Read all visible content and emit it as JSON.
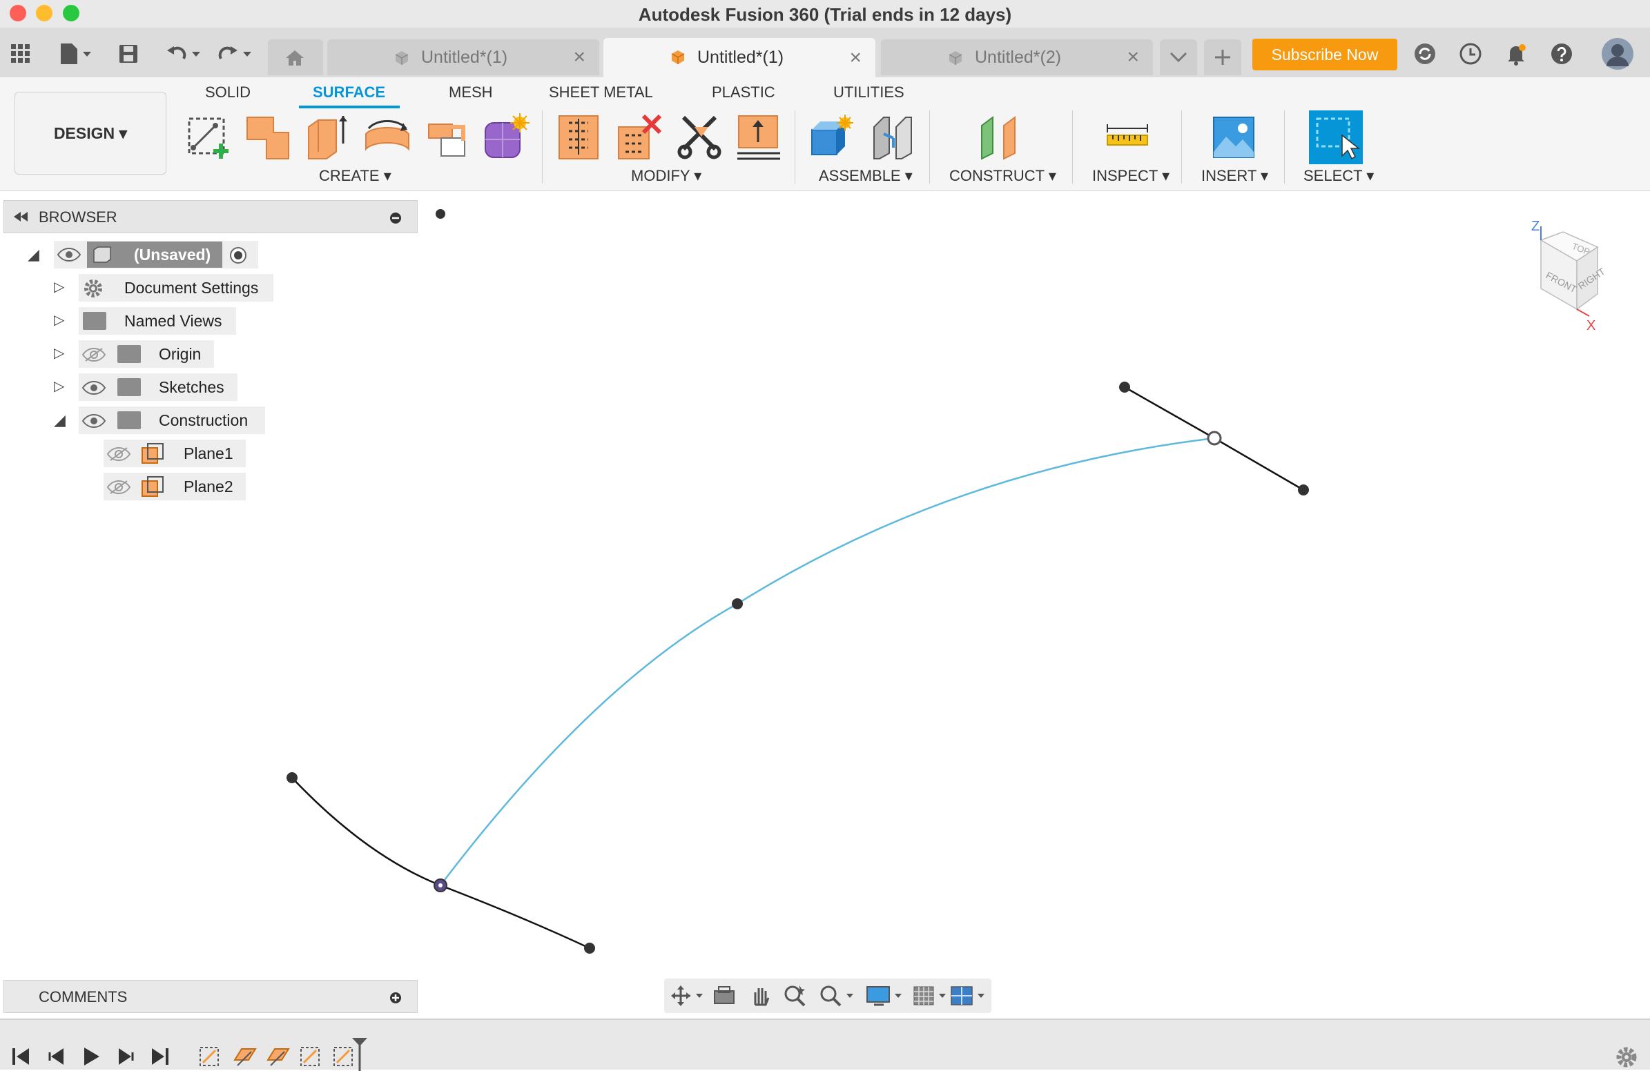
{
  "window": {
    "title": "Autodesk Fusion 360 (Trial ends in 12 days)",
    "traffic_colors": [
      "#fe5f57",
      "#febc2e",
      "#28c840"
    ]
  },
  "tabs": [
    {
      "label": "Untitled*(1)",
      "active": false
    },
    {
      "label": "Untitled*(1)",
      "active": true
    },
    {
      "label": "Untitled*(2)",
      "active": false
    }
  ],
  "subscribe_label": "Subscribe Now",
  "workspace": {
    "label": "DESIGN ▾"
  },
  "ribbon_tabs": [
    "SOLID",
    "SURFACE",
    "MESH",
    "SHEET METAL",
    "PLASTIC",
    "UTILITIES"
  ],
  "active_ribbon_tab": "SURFACE",
  "ribbon_groups": {
    "create": "CREATE ▾",
    "modify": "MODIFY ▾",
    "assemble": "ASSEMBLE ▾",
    "construct": "CONSTRUCT ▾",
    "inspect": "INSPECT ▾",
    "insert": "INSERT ▾",
    "select": "SELECT ▾"
  },
  "browser": {
    "title": "BROWSER",
    "root": "(Unsaved)",
    "items": [
      {
        "label": "Document Settings"
      },
      {
        "label": "Named Views"
      },
      {
        "label": "Origin"
      },
      {
        "label": "Sketches"
      },
      {
        "label": "Construction"
      }
    ],
    "children": [
      {
        "label": "Plane1"
      },
      {
        "label": "Plane2"
      }
    ]
  },
  "comments": {
    "label": "COMMENTS"
  },
  "viewcube": {
    "top": "TOP",
    "front": "FRONT",
    "right": "RIGHT",
    "z": "Z",
    "x": "X"
  },
  "colors": {
    "accent_blue": "#0696d7",
    "subscribe_orange": "#f79a0f",
    "curve_blue": "#5fb8dd"
  }
}
